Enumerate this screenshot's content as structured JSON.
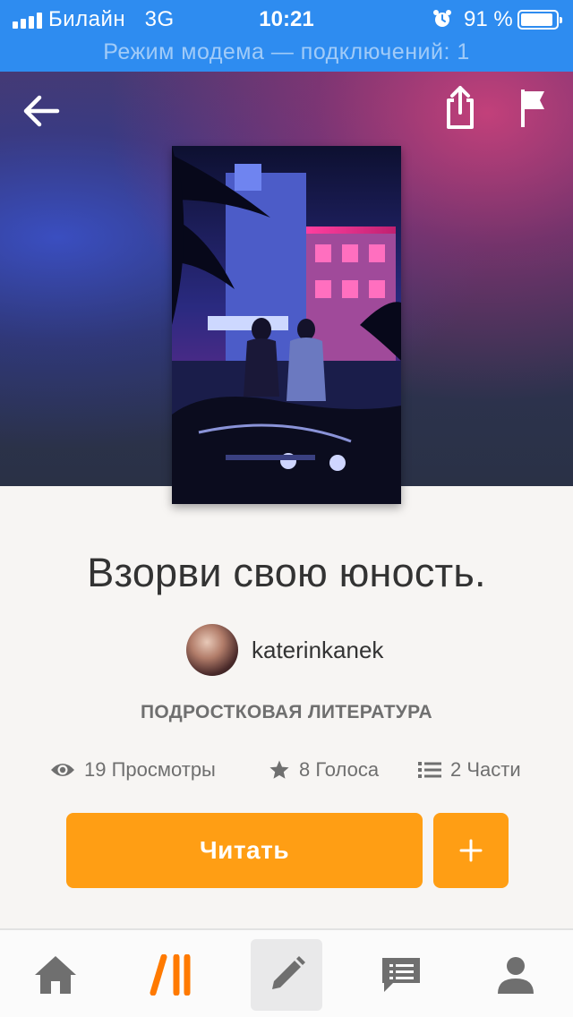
{
  "status_bar": {
    "carrier": "Билайн   3G",
    "time": "10:21",
    "battery_percent": "91 %",
    "battery_level": 0.91,
    "hotspot_text": "Режим модема — подключений: 1"
  },
  "nav": {
    "back_icon": "arrow-left-icon",
    "share_icon": "share-icon",
    "report_icon": "flag-icon"
  },
  "story": {
    "title": "Взорви свою юность.",
    "author": "katerinkanek",
    "category": "ПОДРОСТКОВАЯ ЛИТЕРАТУРА",
    "stats": {
      "views": "19 Просмотры",
      "votes": "8 Голоса",
      "parts": "2 Части"
    }
  },
  "actions": {
    "read_label": "Читать",
    "add_label": "+"
  },
  "tab_bar": {
    "items": [
      "home-icon",
      "library-icon",
      "write-icon",
      "messages-icon",
      "profile-icon"
    ]
  },
  "colors": {
    "accent": "#ff9e14",
    "status_bar": "#2e8cf0",
    "text_dark": "#333333",
    "text_muted": "#6f6f6f",
    "library_accent": "#ff7a00"
  }
}
